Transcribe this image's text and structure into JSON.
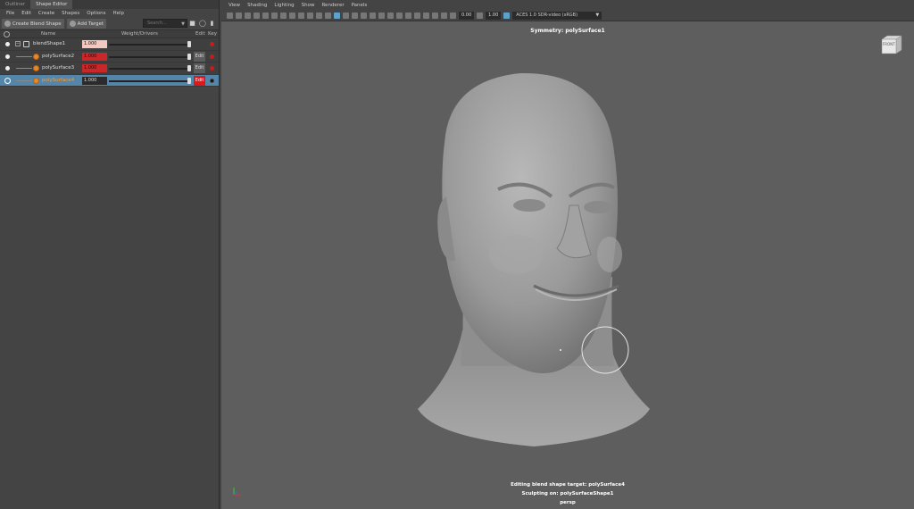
{
  "left_panel": {
    "tabs": [
      "Outliner",
      "Shape Editor"
    ],
    "menu": [
      "File",
      "Edit",
      "Create",
      "Shapes",
      "Options",
      "Help"
    ],
    "toolbar": {
      "create_blend_shape": "Create Blend Shape",
      "add_target": "Add Target",
      "search_placeholder": "Search..."
    },
    "columns": {
      "name": "Name",
      "weight": "Weight/Drivers",
      "edit": "Edit",
      "key": "Key"
    },
    "rows": [
      {
        "name": "blendShape1",
        "weight": "1.000",
        "edit": ""
      },
      {
        "name": "polySurface2",
        "weight": "1.000",
        "edit": "Edit"
      },
      {
        "name": "polySurface3",
        "weight": "1.000",
        "edit": "Edit"
      },
      {
        "name": "polySurface4",
        "weight": "1.000",
        "edit": "Edit"
      }
    ]
  },
  "viewport": {
    "menu": [
      "View",
      "Shading",
      "Lighting",
      "Show",
      "Renderer",
      "Panels"
    ],
    "toolbar": {
      "exposure": "0.00",
      "gamma": "1.00",
      "color_space": "ACES 1.0 SDR-video (sRGB)"
    },
    "symmetry_label": "Symmetry: polySurface1",
    "view_cube_label": "FRONT",
    "status_line1": "Editing blend shape target: polySurface4",
    "status_line2": "Sculpting on: polySurfaceShape1",
    "camera": "persp"
  },
  "colors": {
    "accent_selected": "#5386a8",
    "edit_active": "#e0161a",
    "weight_red": "#c8282a",
    "key_red": "#cc1a1a"
  }
}
